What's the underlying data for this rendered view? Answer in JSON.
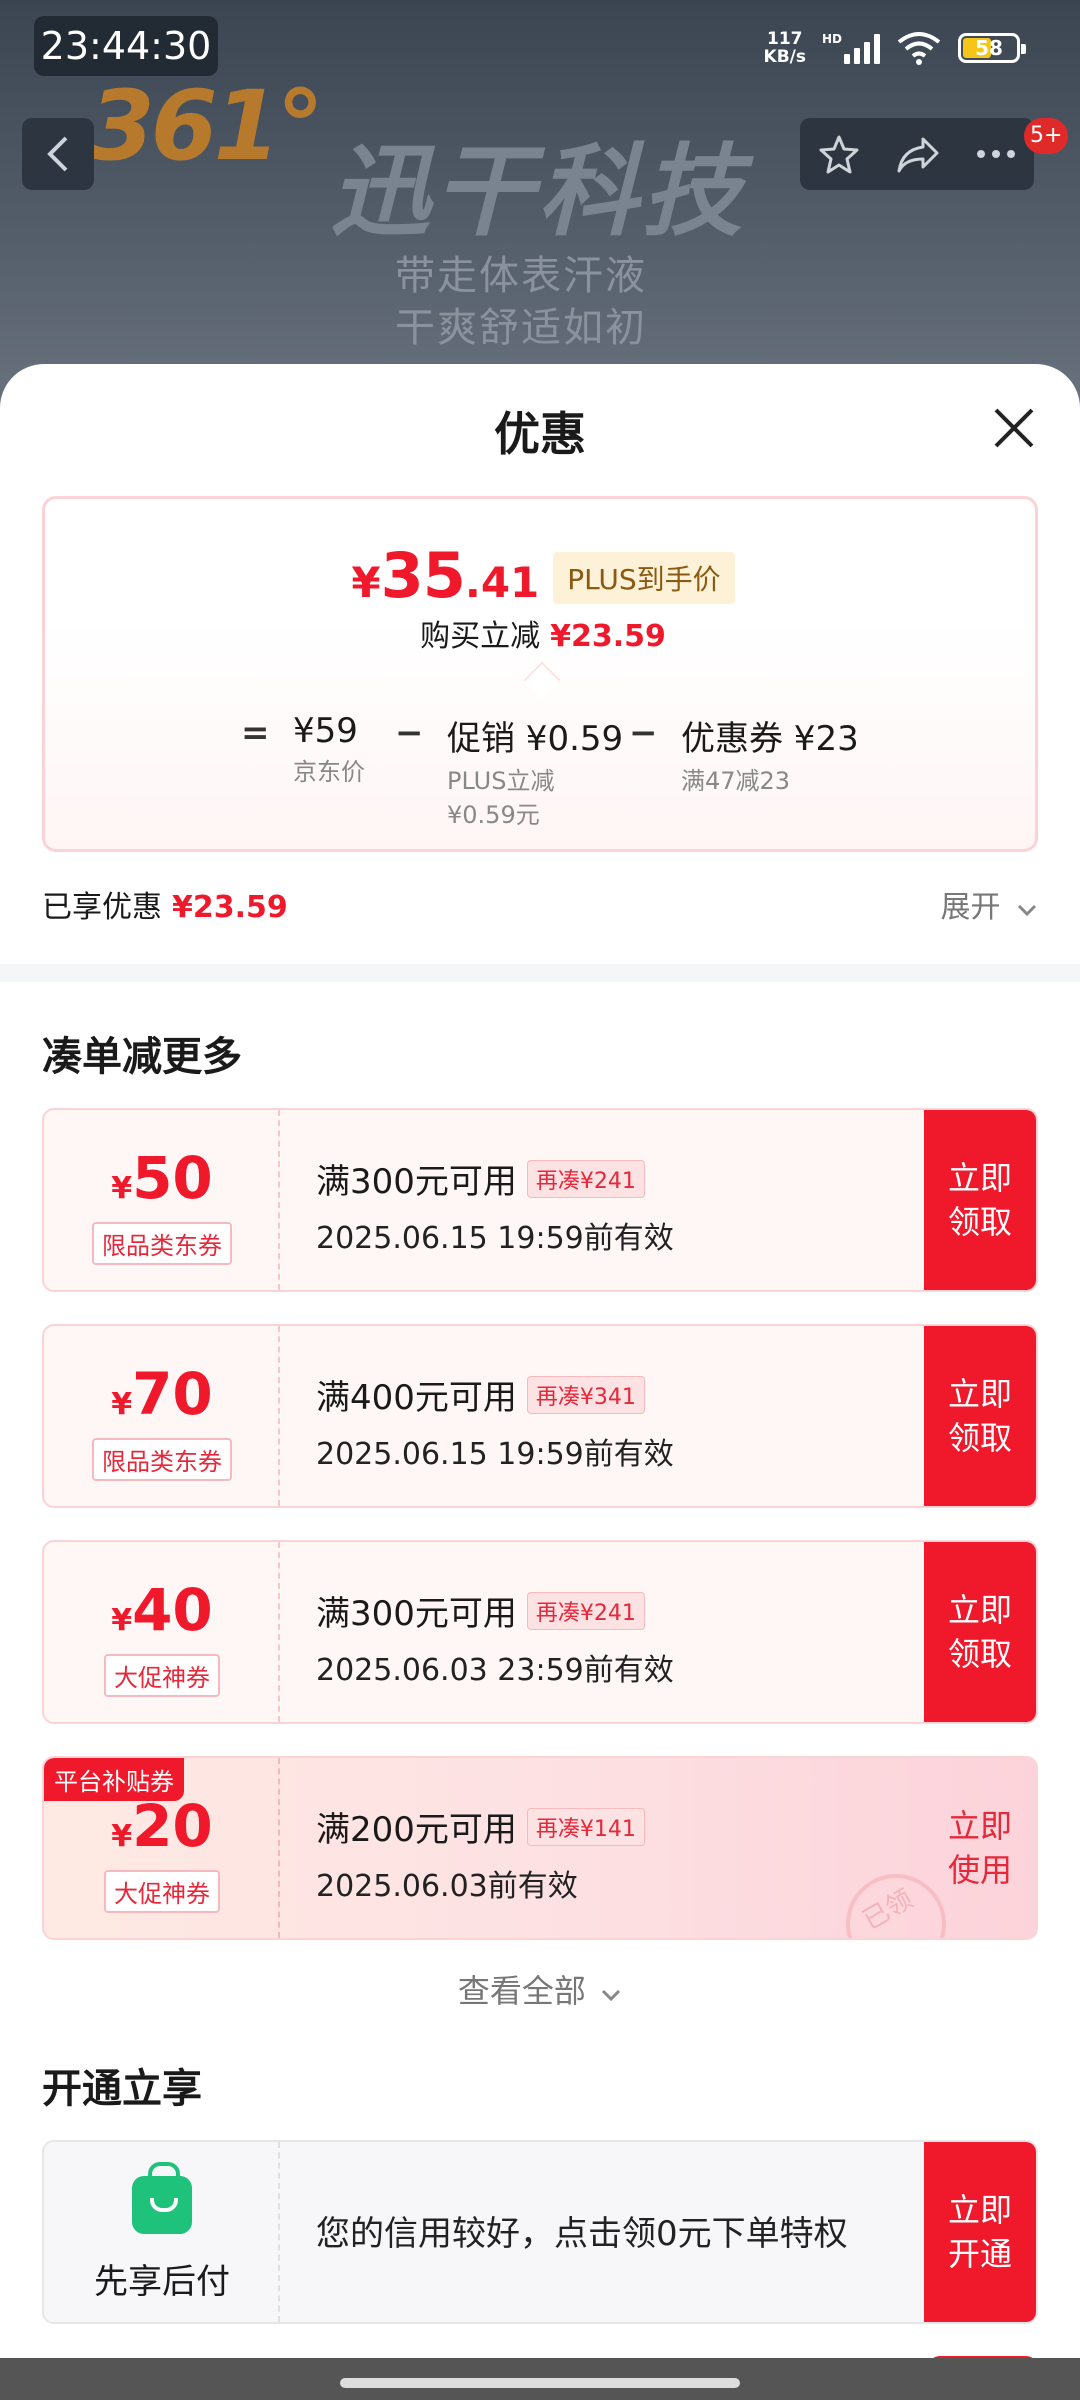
{
  "status_bar": {
    "time": "23:44:30",
    "net_speed_value": "117",
    "net_speed_unit": "KB/s",
    "network_type": "HD",
    "battery": "58"
  },
  "background": {
    "brand_logo": "361°",
    "brand_name": "迅干科技",
    "tagline_line1": "带走体表汗液",
    "tagline_line2": "干爽舒适如初",
    "message_badge": "5+"
  },
  "sheet": {
    "title": "优惠"
  },
  "price_card": {
    "currency": "¥",
    "price_int": "35",
    "price_dec": ".41",
    "plus_tag": "PLUS到手价",
    "instant_label": "购买立减",
    "instant_amount": "¥23.59",
    "equals": "=",
    "minus": "−",
    "jd_price": "¥59",
    "jd_price_label": "京东价",
    "promo_value": "促销 ¥0.59",
    "promo_sub1": "PLUS立减",
    "promo_sub2": "¥0.59元",
    "coupon_value": "优惠券 ¥23",
    "coupon_sub": "满47减23"
  },
  "enjoyed": {
    "label": "已享优惠",
    "amount": "¥23.59",
    "expand": "展开"
  },
  "bundle_section": {
    "title": "凑单减更多",
    "coupons": [
      {
        "yen": "¥",
        "amount": "50",
        "kind": "限品类东券",
        "condition": "满300元可用",
        "more": "再凑¥241",
        "expiry": "2025.06.15 19:59前有效",
        "action_line1": "立即",
        "action_line2": "领取"
      },
      {
        "yen": "¥",
        "amount": "70",
        "kind": "限品类东券",
        "condition": "满400元可用",
        "more": "再凑¥341",
        "expiry": "2025.06.15 19:59前有效",
        "action_line1": "立即",
        "action_line2": "领取"
      },
      {
        "yen": "¥",
        "amount": "40",
        "kind": "大促神券",
        "condition": "满300元可用",
        "more": "再凑¥241",
        "expiry": "2025.06.03 23:59前有效",
        "action_line1": "立即",
        "action_line2": "领取"
      },
      {
        "yen": "¥",
        "amount": "20",
        "kind": "大促神券",
        "condition": "满200元可用",
        "more": "再凑¥141",
        "expiry": "2025.06.03前有效",
        "action_line1": "立即",
        "action_line2": "使用",
        "tag": "平台补贴券",
        "stamp": "已领"
      }
    ],
    "view_all": "查看全部"
  },
  "open_section": {
    "title": "开通立享",
    "card_label": "先享后付",
    "card_text": "您的信用较好，点击领0元下单特权",
    "action_line1": "立即",
    "action_line2": "开通"
  },
  "colors": {
    "accent_red": "#f0192c",
    "plus_gold": "#8a5a12",
    "pay_green": "#1ec27a"
  }
}
